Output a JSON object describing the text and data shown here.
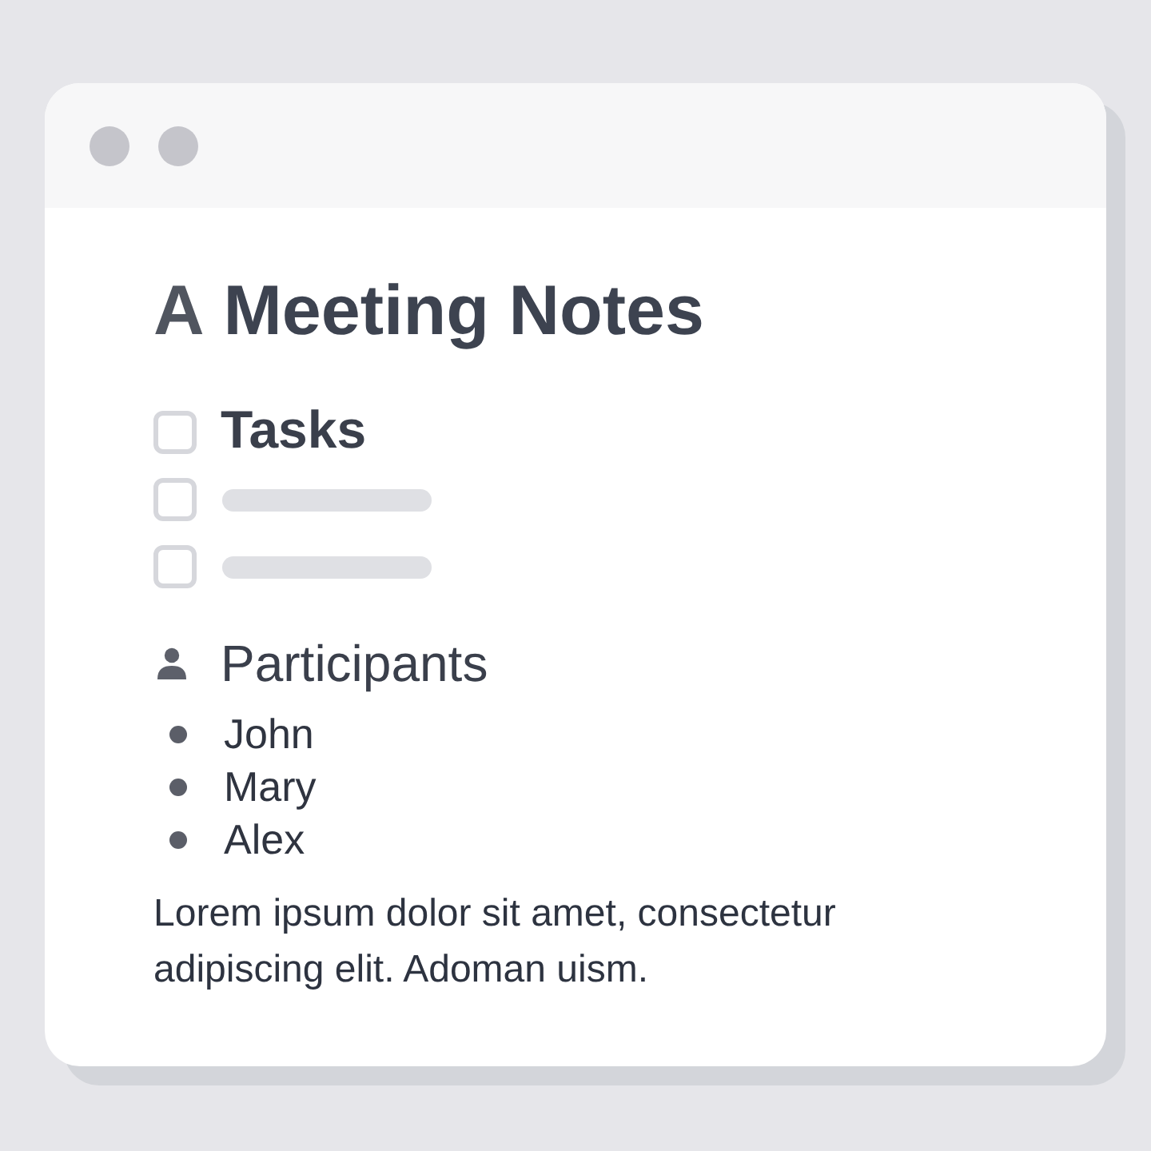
{
  "document": {
    "title_mark": "A",
    "title": "Meeting Notes"
  },
  "tasks": {
    "heading": "Tasks",
    "heading_checked": false,
    "items": [
      {
        "checked": false
      },
      {
        "checked": false
      }
    ]
  },
  "participants": {
    "heading": "Participants",
    "names": [
      "John",
      "Mary",
      "Alex"
    ]
  },
  "paragraph": "Lorem ipsum dolor sit amet, consectetur adipiscing elit. Adoman uism."
}
